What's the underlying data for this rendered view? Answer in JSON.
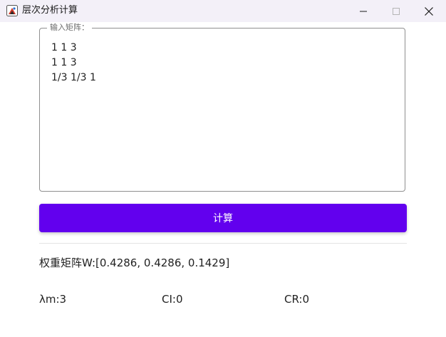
{
  "window": {
    "title": "层次分析计算",
    "icons": {
      "app": "java-app-icon",
      "minimize": "minimize-icon",
      "maximize": "maximize-icon",
      "close": "close-icon"
    }
  },
  "input": {
    "legend": "输入矩阵：",
    "matrix_text": "1 1 3\n1 1 3\n1/3 1/3 1"
  },
  "actions": {
    "calculate_label": "计算"
  },
  "results": {
    "weights_text": "权重矩阵W:[0.4286, 0.4286, 0.1429]",
    "lambda_text": "λm:3",
    "ci_text": "CI:0",
    "cr_text": "CR:0"
  },
  "colors": {
    "accent": "#6200ee",
    "titlebar_bg": "#f3f0f8",
    "border": "#8f8f8f"
  }
}
